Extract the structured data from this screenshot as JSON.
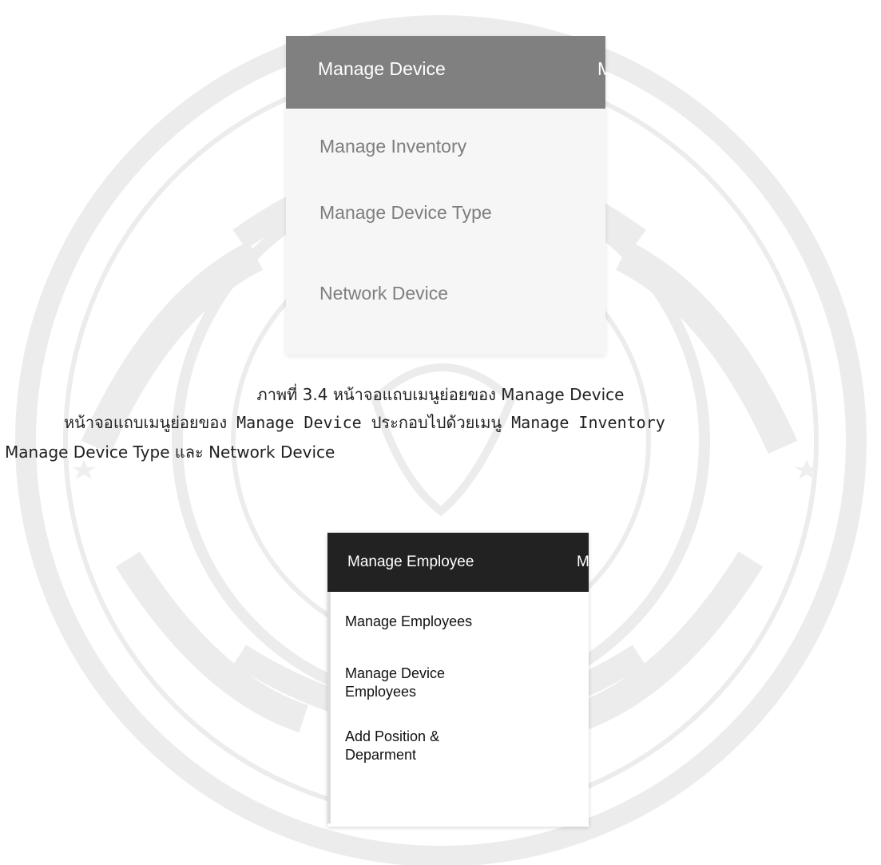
{
  "figure1": {
    "menubar": {
      "active_label": "Manage Device",
      "next_label": "Ma",
      "background": "#808080"
    },
    "submenu_items": [
      "Manage Inventory",
      "Manage Device Type",
      "Network Device"
    ]
  },
  "caption": "ภาพที่ 3.4 หน้าจอแถบเมนูย่อยของ Manage Device",
  "paragraph": {
    "line1": "หน้าจอแถบเมนูย่อยของ Manage Device ประกอบไปด้วยเมนู Manage Inventory",
    "line2": "Manage Device Type และ Network Device"
  },
  "figure2": {
    "menubar": {
      "active_label": "Manage Employee",
      "next_label": "Ma",
      "background": "#222222"
    },
    "submenu_items": [
      "Manage Employees",
      "Manage Device Employees",
      "Add Position & Deparment"
    ]
  }
}
